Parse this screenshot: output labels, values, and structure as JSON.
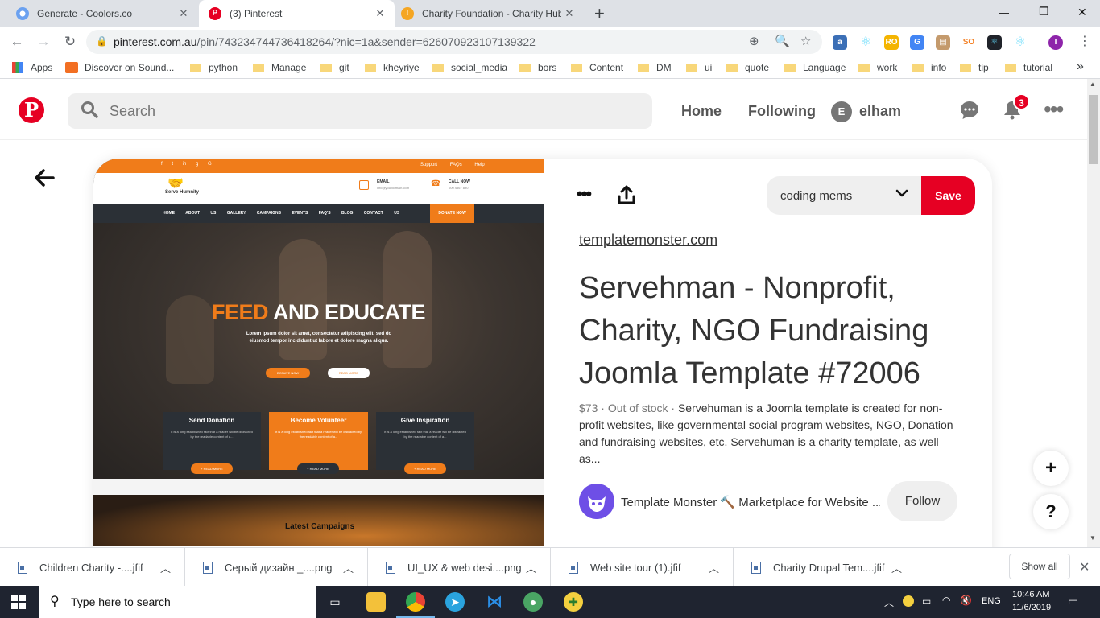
{
  "browser": {
    "tabs": [
      {
        "title": "Generate - Coolors.co",
        "favicon": "coolors-icon",
        "color": "#6ba1f0",
        "active": false
      },
      {
        "title": "(3) Pinterest",
        "favicon": "pinterest-icon",
        "color": "#e60023",
        "active": true
      },
      {
        "title": "Charity Foundation - Charity Hub",
        "favicon": "info-icon",
        "color": "#f5a623",
        "active": false
      }
    ],
    "new_tab": "+",
    "url_host": "pinterest.com.au",
    "url_path": "/pin/743234744736418264/?nic=1a&sender=626070923107139322",
    "window_controls": [
      "—",
      "❐",
      "✕"
    ]
  },
  "bookmarks": [
    {
      "label": "Apps",
      "type": "apps"
    },
    {
      "label": "Discover on Sound...",
      "type": "soundcloud"
    },
    {
      "label": "python",
      "type": "folder"
    },
    {
      "label": "Manage",
      "type": "folder"
    },
    {
      "label": "git",
      "type": "folder"
    },
    {
      "label": "kheyriye",
      "type": "folder"
    },
    {
      "label": "social_media",
      "type": "folder"
    },
    {
      "label": "bors",
      "type": "folder"
    },
    {
      "label": "Content",
      "type": "folder"
    },
    {
      "label": "DM",
      "type": "folder"
    },
    {
      "label": "ui",
      "type": "folder"
    },
    {
      "label": "quote",
      "type": "folder"
    },
    {
      "label": "Language",
      "type": "folder"
    },
    {
      "label": "work",
      "type": "folder"
    },
    {
      "label": "info",
      "type": "folder"
    },
    {
      "label": "tip",
      "type": "folder"
    },
    {
      "label": "tutorial",
      "type": "folder"
    }
  ],
  "bookmarks_more": "»",
  "header": {
    "search_placeholder": "Search",
    "nav_home": "Home",
    "nav_following": "Following",
    "user_initial": "E",
    "user_name": "elham",
    "notification_count": "3"
  },
  "pin": {
    "board": "coding mems",
    "save_label": "Save",
    "source": "templatemonster.com",
    "title": "Servehman - Nonprofit, Charity, NGO Fundraising Joomla Template #72006",
    "price": "$73",
    "stock": "Out of stock",
    "description": "Servehuman is a Joomla template is created for non-profit websites, like governmental social program websites, NGO, Donation and fundraising websites, etc. Servehuman is a charity template, as well as...",
    "author": "Template Monster 🔨 Marketplace for Website ...",
    "follow_label": "Follow",
    "image": {
      "social": [
        "f",
        "t",
        "in",
        "g",
        "G+"
      ],
      "top_links": [
        "Support",
        "FAQs",
        "Help"
      ],
      "logo_text": "Serve Humnity",
      "email_label": "EMAIL",
      "email_value": "info@yourdomain.com",
      "call_label": "CALL NOW",
      "call_value": "000 4567 890",
      "menu": [
        "HOME",
        "ABOUT US",
        "GALLERY",
        "CAMPAIGNS",
        "EVENTS",
        "FAQ'S",
        "BLOG",
        "CONTACT US"
      ],
      "donate_label": "DONATE NOW",
      "hero_orange": "FEED",
      "hero_white": "AND EDUCATE",
      "hero_text": "Lorem ipsum dolor sit amet, consectetur adipiscing elit, sed do eiusmod tempor incididunt ut labore et dolore magna aliqua.",
      "hero_btn1": "DONATE NOW",
      "hero_btn2": "READ MORE",
      "boxes": [
        {
          "title": "Send Donation",
          "text": "It is a long established fact that a reader will be distracted by the readable content of a...",
          "btn": "+ READ MORE"
        },
        {
          "title": "Become Volunteer",
          "text": "It is a long established fact that a reader will be distracted by the readable content of a...",
          "btn": "+ READ MORE"
        },
        {
          "title": "Give Inspiration",
          "text": "It is a long established fact that a reader will be distracted by the readable content of a...",
          "btn": "+ READ MORE"
        }
      ],
      "latest": "Latest Campaigns"
    }
  },
  "fab_plus": "+",
  "fab_help": "?",
  "downloads": {
    "items": [
      "Children Charity -....jfif",
      "Серый дизайн _....png",
      "UI_UX & web desi....png",
      "Web site tour (1).jfif",
      "Charity Drupal Tem....jfif"
    ],
    "show_all": "Show all"
  },
  "taskbar": {
    "search_placeholder": "Type here to search",
    "lang": "ENG",
    "time": "10:46 AM",
    "date": "11/6/2019"
  },
  "colors": {
    "brand": "#e60023",
    "accent_orange": "#f07c1a"
  }
}
